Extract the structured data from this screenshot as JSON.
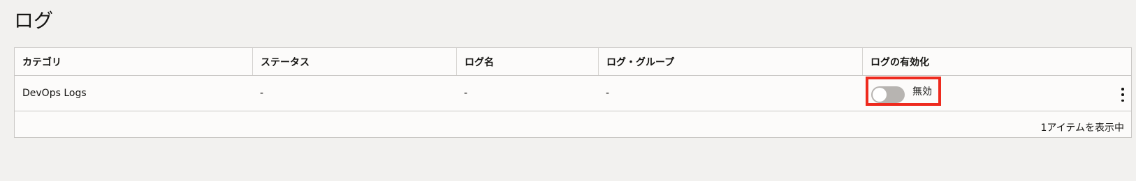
{
  "page": {
    "title": "ログ"
  },
  "table": {
    "columns": [
      "カテゴリ",
      "ステータス",
      "ログ名",
      "ログ・グループ",
      "ログの有効化"
    ],
    "rows": [
      {
        "category": "DevOps Logs",
        "status": "-",
        "log_name": "-",
        "log_group": "-",
        "enable_toggle": {
          "state": "off",
          "label": "無効"
        }
      }
    ],
    "footer": "1アイテムを表示中"
  },
  "colors": {
    "highlight_border": "#ee2a1e",
    "toggle_off_track": "#b7b4b1"
  },
  "icons": {
    "row_actions": "kebab-menu-icon"
  }
}
